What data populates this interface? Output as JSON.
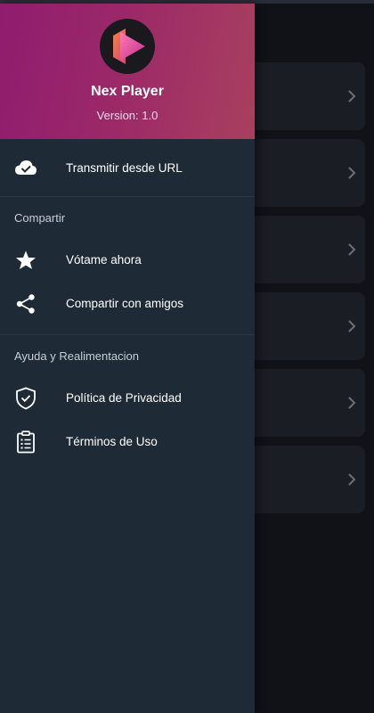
{
  "drawer": {
    "app_name": "Nex Player",
    "version": "Version: 1.0",
    "stream_item": {
      "label": "Transmitir desde URL",
      "icon": "cloud-check-icon"
    },
    "share_section": {
      "title": "Compartir",
      "items": [
        {
          "label": "Vótame ahora",
          "icon": "star-icon"
        },
        {
          "label": "Compartir con amigos",
          "icon": "share-icon"
        }
      ]
    },
    "help_section": {
      "title": "Ayuda y Realimentacion",
      "items": [
        {
          "label": "Política de Privacidad",
          "icon": "shield-check-icon"
        },
        {
          "label": "Términos de Uso",
          "icon": "clipboard-list-icon"
        }
      ]
    }
  },
  "colors": {
    "header_gradient_start": "#8f1c6e",
    "header_gradient_end": "#a8405e",
    "drawer_bg": "#1e2a36",
    "background": "#101218",
    "card_bg": "#1b1d25"
  }
}
